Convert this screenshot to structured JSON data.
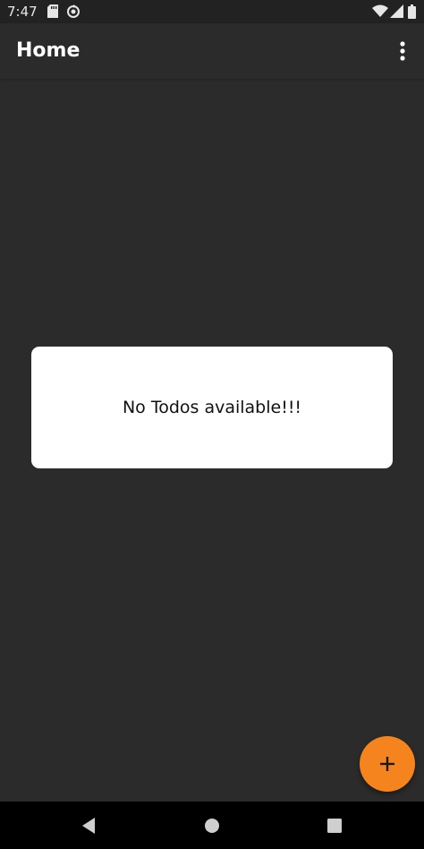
{
  "status_bar": {
    "time": "7:47",
    "icons": [
      "sd-card-icon",
      "sync-icon",
      "wifi-icon",
      "signal-icon",
      "battery-icon"
    ]
  },
  "app_bar": {
    "title": "Home",
    "overflow_icon": "more-vert-icon"
  },
  "empty_state": {
    "message": "No Todos available!!!"
  },
  "fab": {
    "icon": "plus-icon",
    "color": "#f5841f"
  },
  "nav_bar": {
    "icons": [
      "back-icon",
      "home-icon",
      "recents-icon"
    ]
  },
  "colors": {
    "background": "#2b2b2b",
    "status_bar": "#222222",
    "dialog": "#ffffff",
    "accent": "#f5841f"
  }
}
